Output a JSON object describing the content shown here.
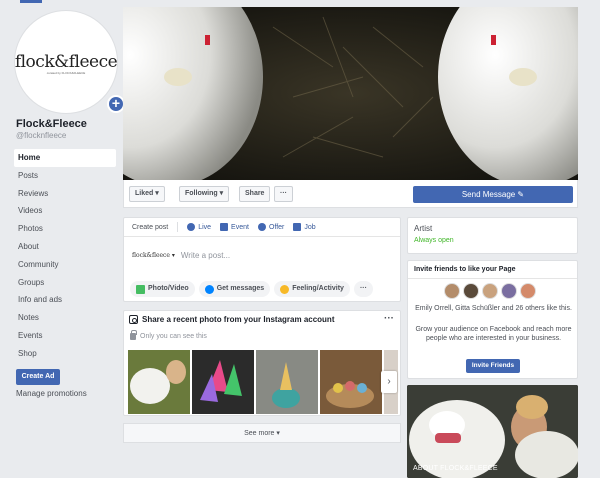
{
  "page": {
    "name": "Flock&Fleece",
    "handle": "@flocknfleece",
    "logo_text": "flock&fleece",
    "logo_subtext": "curated by FLOCK&FLEECE"
  },
  "sidebar": {
    "items": [
      {
        "label": "Home",
        "active": true
      },
      {
        "label": "Posts"
      },
      {
        "label": "Reviews"
      },
      {
        "label": "Videos"
      },
      {
        "label": "Photos"
      },
      {
        "label": "About"
      },
      {
        "label": "Community"
      },
      {
        "label": "Groups"
      },
      {
        "label": "Info and ads"
      },
      {
        "label": "Notes"
      },
      {
        "label": "Events"
      },
      {
        "label": "Shop"
      }
    ],
    "create_ad": "Create Ad",
    "manage_promotions": "Manage promotions"
  },
  "actions": {
    "liked": "Liked ▾",
    "following": "Following ▾",
    "share": "Share",
    "more": "···",
    "send_message": "Send Message ✎"
  },
  "composer": {
    "tabs": [
      "Create post",
      "Live",
      "Event",
      "Offer",
      "Job"
    ],
    "account": "flock&fleece ▾",
    "placeholder": "Write a post...",
    "chips": [
      "Photo/Video",
      "Get messages",
      "Feeling/Activity",
      "···"
    ]
  },
  "instagram": {
    "title": "Share a recent photo from your Instagram account",
    "privacy": "Only you can see this",
    "more": "···",
    "next": "›"
  },
  "see_more": "See more ▾",
  "artist": {
    "category": "Artist",
    "status": "Always open"
  },
  "invite": {
    "title": "Invite friends to like your Page",
    "likes_text": "Emily Orrell, Gitta Schüßler and 26 others like this.",
    "grow_text": "Grow your audience on Facebook and reach more people who are interested in your business.",
    "button": "Invite Friends"
  },
  "about": {
    "label": "ABOUT FLOCK&FLEECE"
  },
  "colors": {
    "brand_blue": "#4267b2",
    "link_blue": "#365899",
    "open_green": "#42b72a",
    "background": "#e9ebee"
  }
}
